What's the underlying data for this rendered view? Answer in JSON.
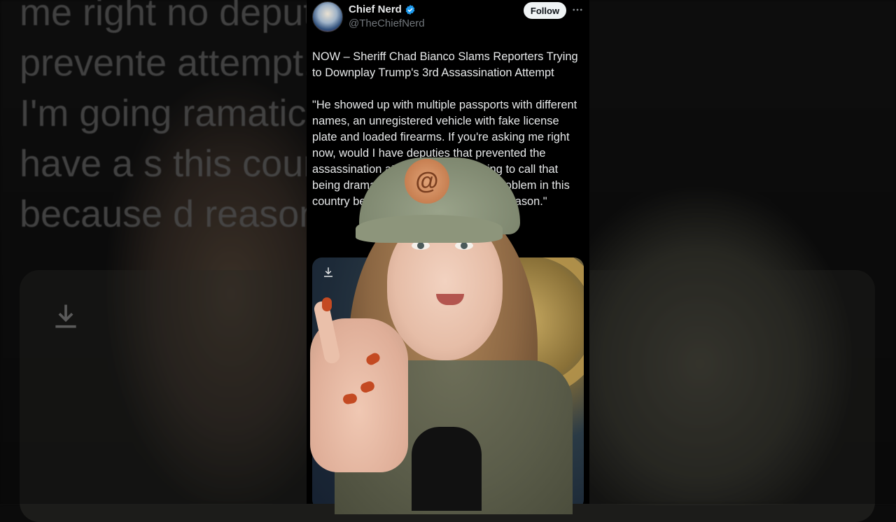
{
  "background": {
    "text_fragments": "me right no                    deputies that\nprevente                    attempt...And\nI'm going                    ramatic? We\nhave a s                    this country\nbecause                    d reason.\""
  },
  "tweet": {
    "display_name": "Chief Nerd",
    "handle": "@TheChiefNerd",
    "follow_label": "Follow",
    "text": "NOW – Sheriff Chad Bianco Slams Reporters Trying to Downplay Trump's 3rd Assassination Attempt\n\n\"He showed up with multiple passports with different names, an unregistered vehicle with fake license plate and loaded firearms. If you're asking me right now, would I have deputies that prevented the assassination attempt...And I'm going to call that being dramatic? We have a serious problem in this country because of lack of civility and reason.\""
  },
  "icons": {
    "verified": "verified-badge-icon",
    "more": "more-options-icon",
    "download": "download-icon"
  },
  "colors": {
    "verified_blue": "#1d9bf0",
    "text_primary": "#e7e9ea",
    "text_secondary": "#71767b",
    "follow_bg": "#eff3f4"
  }
}
